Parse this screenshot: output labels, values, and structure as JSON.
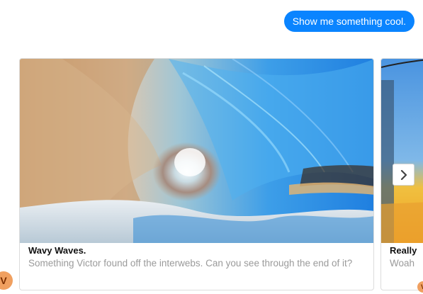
{
  "conversation": {
    "user_message": "Show me something cool."
  },
  "carousel": {
    "cards": [
      {
        "title": "Wavy Waves.",
        "subtitle": "Something Victor found off the interwebs. Can you see through the end of it?"
      },
      {
        "title": "Really",
        "subtitle": "Woah"
      }
    ],
    "next_icon": "chevron-right-icon"
  },
  "bot": {
    "avatar_initial": "V",
    "avatar_color": "#f0a060"
  },
  "colors": {
    "user_bubble": "#0a84ff",
    "subtitle_text": "#9a9a9a"
  }
}
